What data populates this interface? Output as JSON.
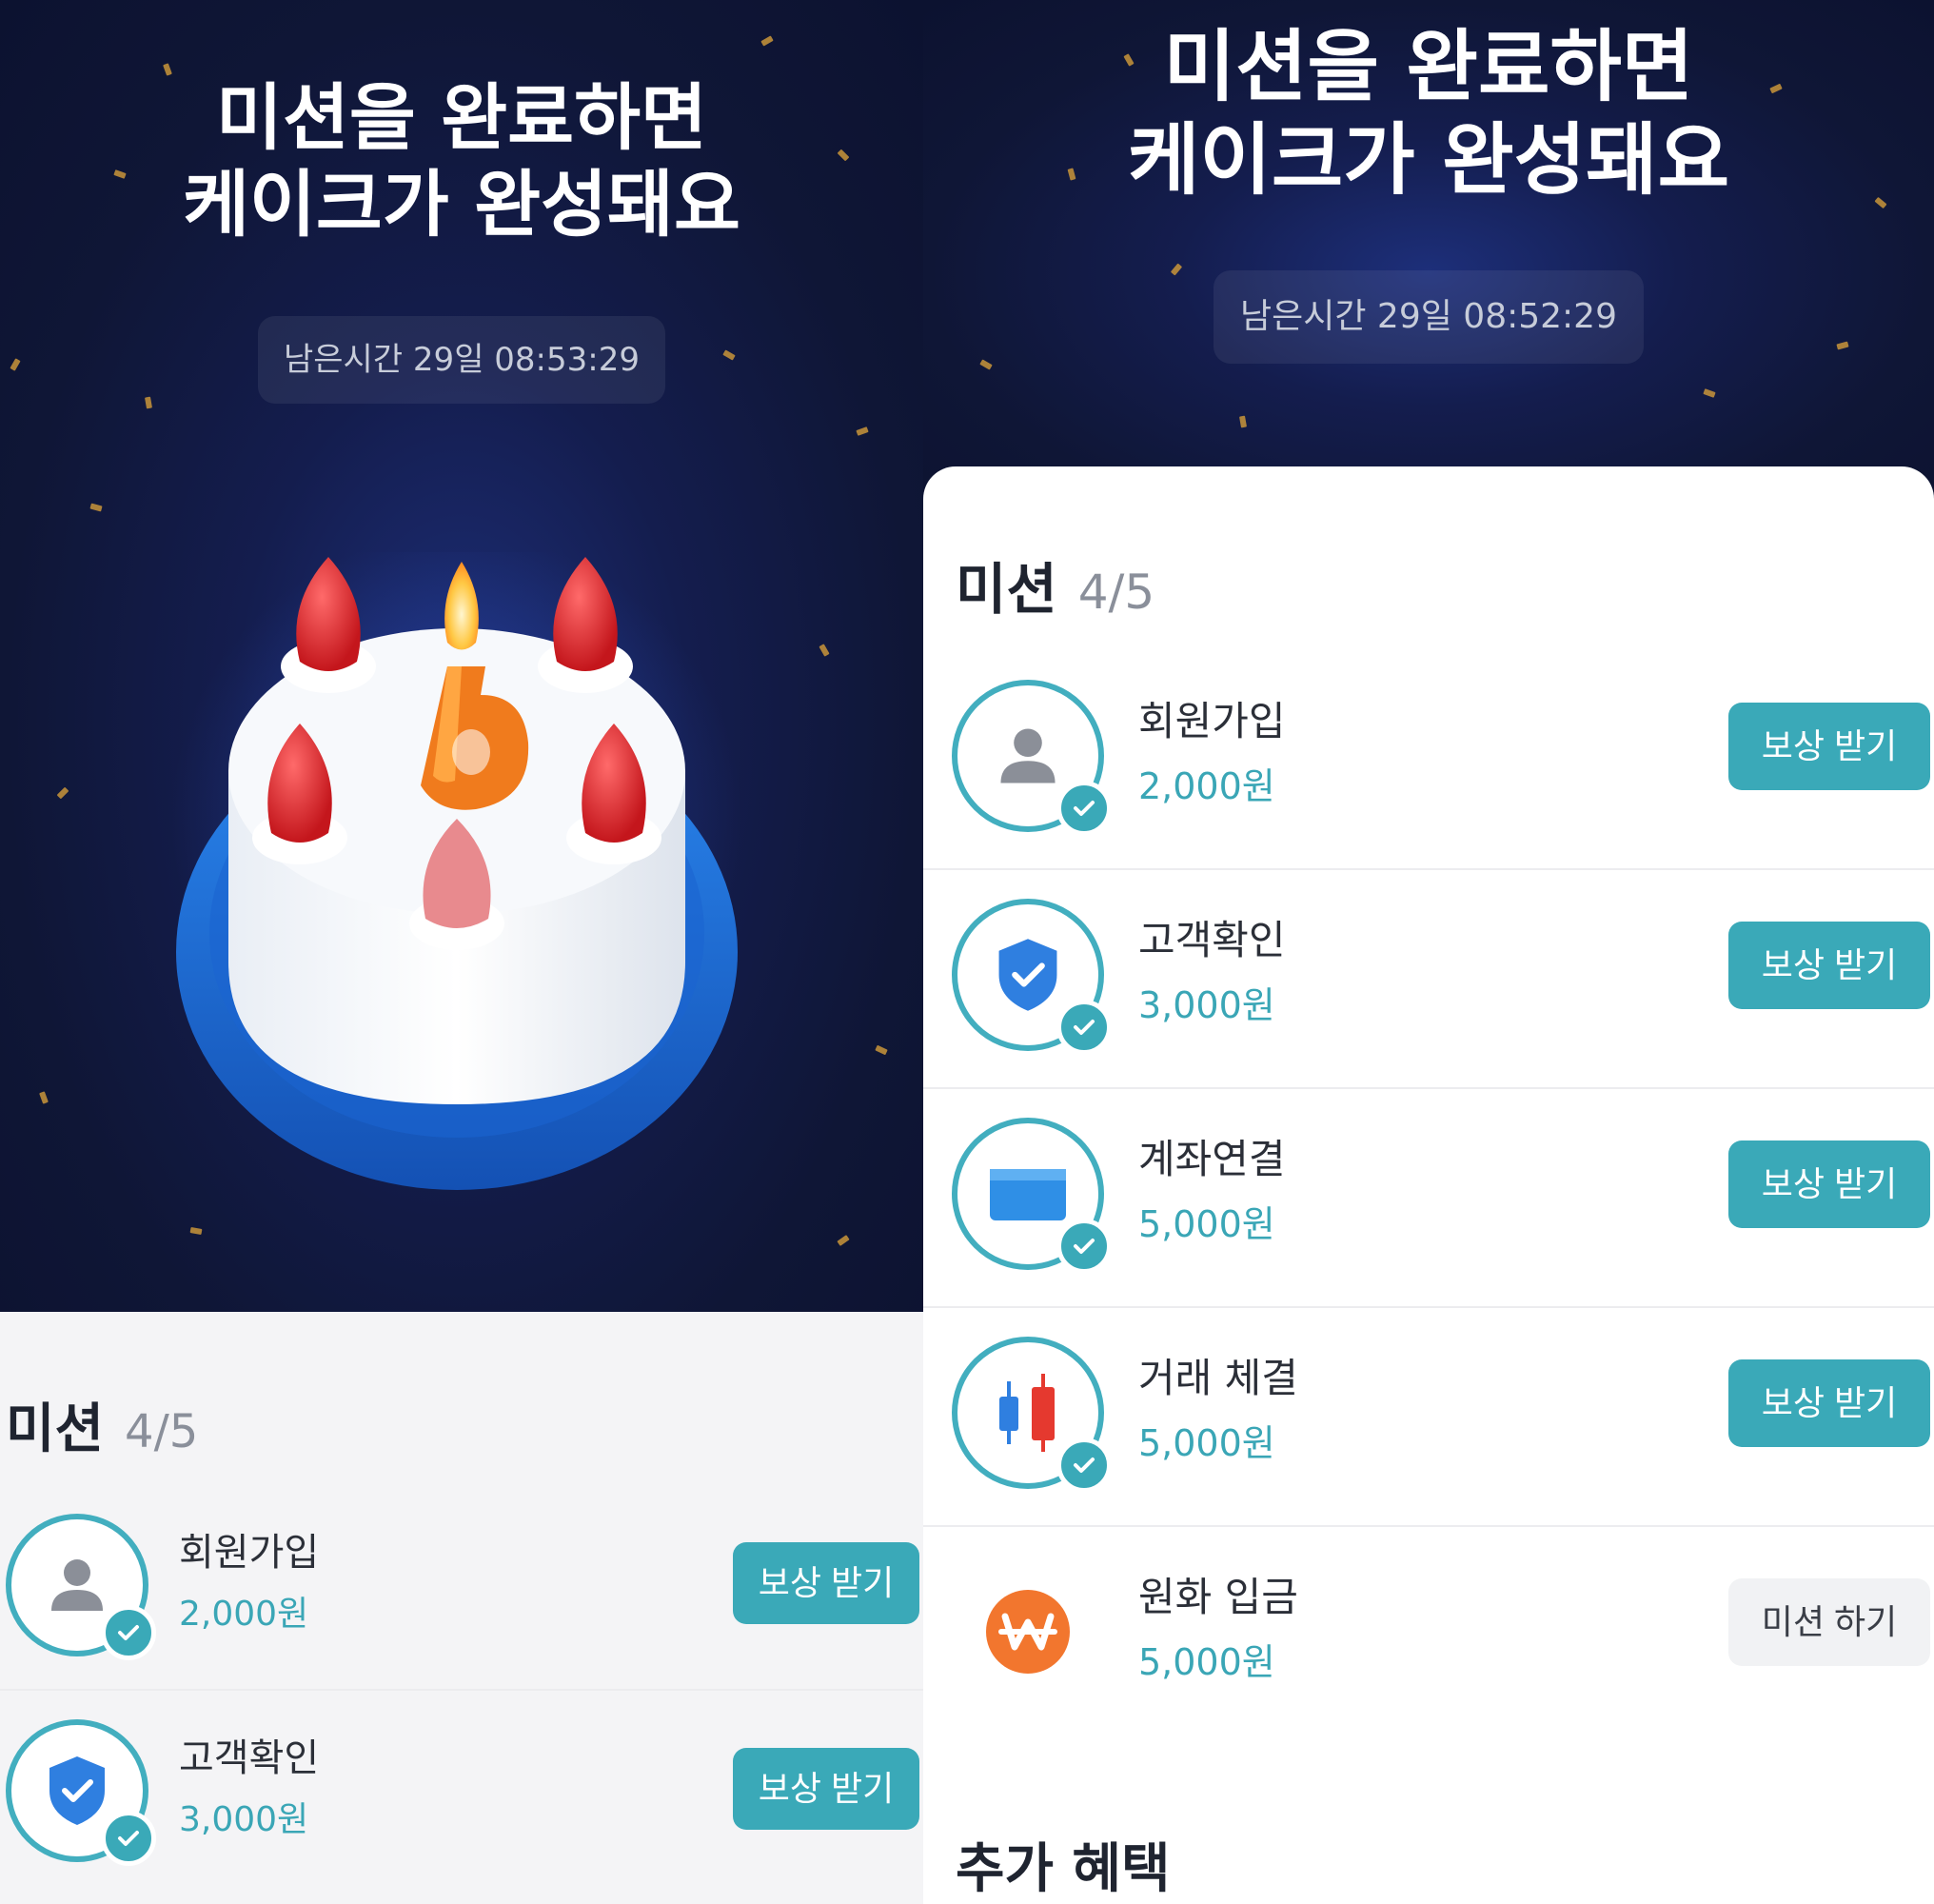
{
  "left_panel": {
    "hero": {
      "title_line1": "미션을 완료하면",
      "title_line2": "케이크가 완성돼요",
      "timer": "남은시간 29일 08:53:29"
    },
    "missions": {
      "title": "미션",
      "count": "4/5",
      "items": [
        {
          "name": "회원가입",
          "amount": "2,000원",
          "button": "보상 받기",
          "icon": "person-icon"
        },
        {
          "name": "고객확인",
          "amount": "3,000원",
          "button": "보상 받기",
          "icon": "shield-check-icon"
        }
      ]
    }
  },
  "right_panel": {
    "hero": {
      "title_line1": "미션을 완료하면",
      "title_line2": "케이크가 완성돼요",
      "timer": "남은시간 29일 08:52:29"
    },
    "missions": {
      "title": "미션",
      "count": "4/5",
      "items": [
        {
          "name": "회원가입",
          "amount": "2,000원",
          "button": "보상 받기",
          "icon": "person-icon"
        },
        {
          "name": "고객확인",
          "amount": "3,000원",
          "button": "보상 받기",
          "icon": "shield-check-icon"
        },
        {
          "name": "계좌연결",
          "amount": "5,000원",
          "button": "보상 받기",
          "icon": "bank-card-icon"
        },
        {
          "name": "거래 체결",
          "amount": "5,000원",
          "button": "보상 받기",
          "icon": "candlestick-icon"
        },
        {
          "name": "원화 입금",
          "amount": "5,000원",
          "button": "미션 하기",
          "icon": "won-coin-icon"
        }
      ]
    },
    "extra_title": "추가 혜택"
  },
  "colors": {
    "accent": "#3aa9b8",
    "hero_bg": "#111a3d",
    "confetti": "#c9953a",
    "plate": "#1e6fd6",
    "won_coin": "#f2762e"
  }
}
